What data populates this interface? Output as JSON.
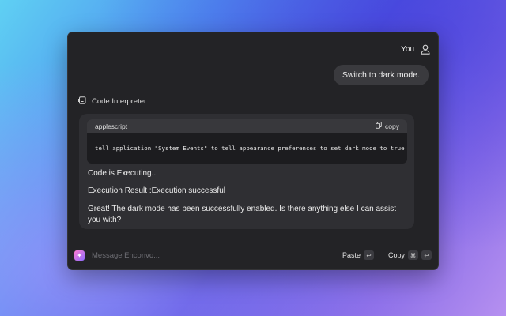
{
  "user": {
    "name": "You",
    "icon": "person-icon"
  },
  "user_message": "Switch to dark mode.",
  "assistant": {
    "tool_label": "Code Interpreter",
    "tool_icon": "code-interpreter-icon",
    "code": {
      "language": "applescript",
      "copy_label": "copy",
      "content": "tell application \"System Events\" to tell appearance preferences to set dark mode to true"
    },
    "status": "Code is Executing...",
    "result": "Execution Result :Execution successful",
    "reply": "Great! The dark mode has been successfully enabled. Is there anything else I can assist you with?"
  },
  "composer": {
    "placeholder": "Message Enconvo...",
    "paste_label": "Paste",
    "paste_key": "↩",
    "copy_label": "Copy",
    "copy_keys": [
      "⌘",
      "↩"
    ]
  },
  "colors": {
    "window_bg": "#232326",
    "bubble_bg": "#3a3a3e",
    "assistant_bg": "#2f2f33",
    "code_bg": "#1c1c1f"
  }
}
